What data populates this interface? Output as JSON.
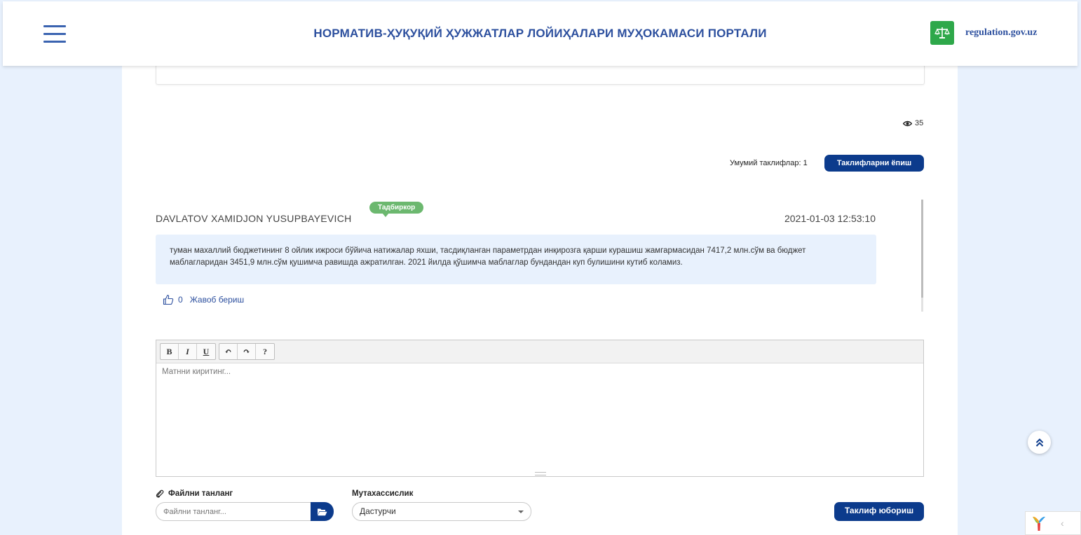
{
  "header": {
    "title": "НОРМАТИВ-ҲУҚУҚИЙ ҲУЖЖАТЛАР ЛОЙИҲАЛАРИ МУҲОКАМАСИ ПОРТАЛИ",
    "site_name": "regulation.gov.uz"
  },
  "stats": {
    "views": "35",
    "total_label": "Умумий таклифлар: 1",
    "collapse_button": "Таклифларни ёпиш"
  },
  "comment": {
    "author": "DAVLATOV XAMIDJON YUSUPBAYEVICH",
    "role": "Тадбиркор",
    "date": "2021-01-03 12:53:10",
    "text": "туман махаллий бюджетининг 8 ойлик ижроси бўйича натижалар яхши, тасдиқланган параметрдан инқирозга қарши курашиш жамгармасидан 7417,2 млн.сўм ва бюджет маблагларидан 3451,9 млн.сўм қушимча равишда ажратилган. 2021 йилда қўшимча маблаглар бундандан куп булишини кутиб коламиз.",
    "likes": "0",
    "reply_label": "Жавоб бериш"
  },
  "editor": {
    "toolbar": [
      "B",
      "I",
      "U",
      "↶",
      "↷",
      "?"
    ],
    "placeholder": "Матнни киритинг..."
  },
  "form": {
    "file_label": "Файлни танланг",
    "file_placeholder": "Файлни танланг...",
    "spec_label": "Мутахассислик",
    "spec_value": "Дастурчи",
    "submit_label": "Таклиф юбориш"
  },
  "colors": {
    "brand_blue": "#0c3b8c",
    "title_blue": "#2c4f9e",
    "badge_green": "#6cb86f",
    "logo_green": "#2ea84a",
    "page_bg": "#e8f1fd"
  }
}
